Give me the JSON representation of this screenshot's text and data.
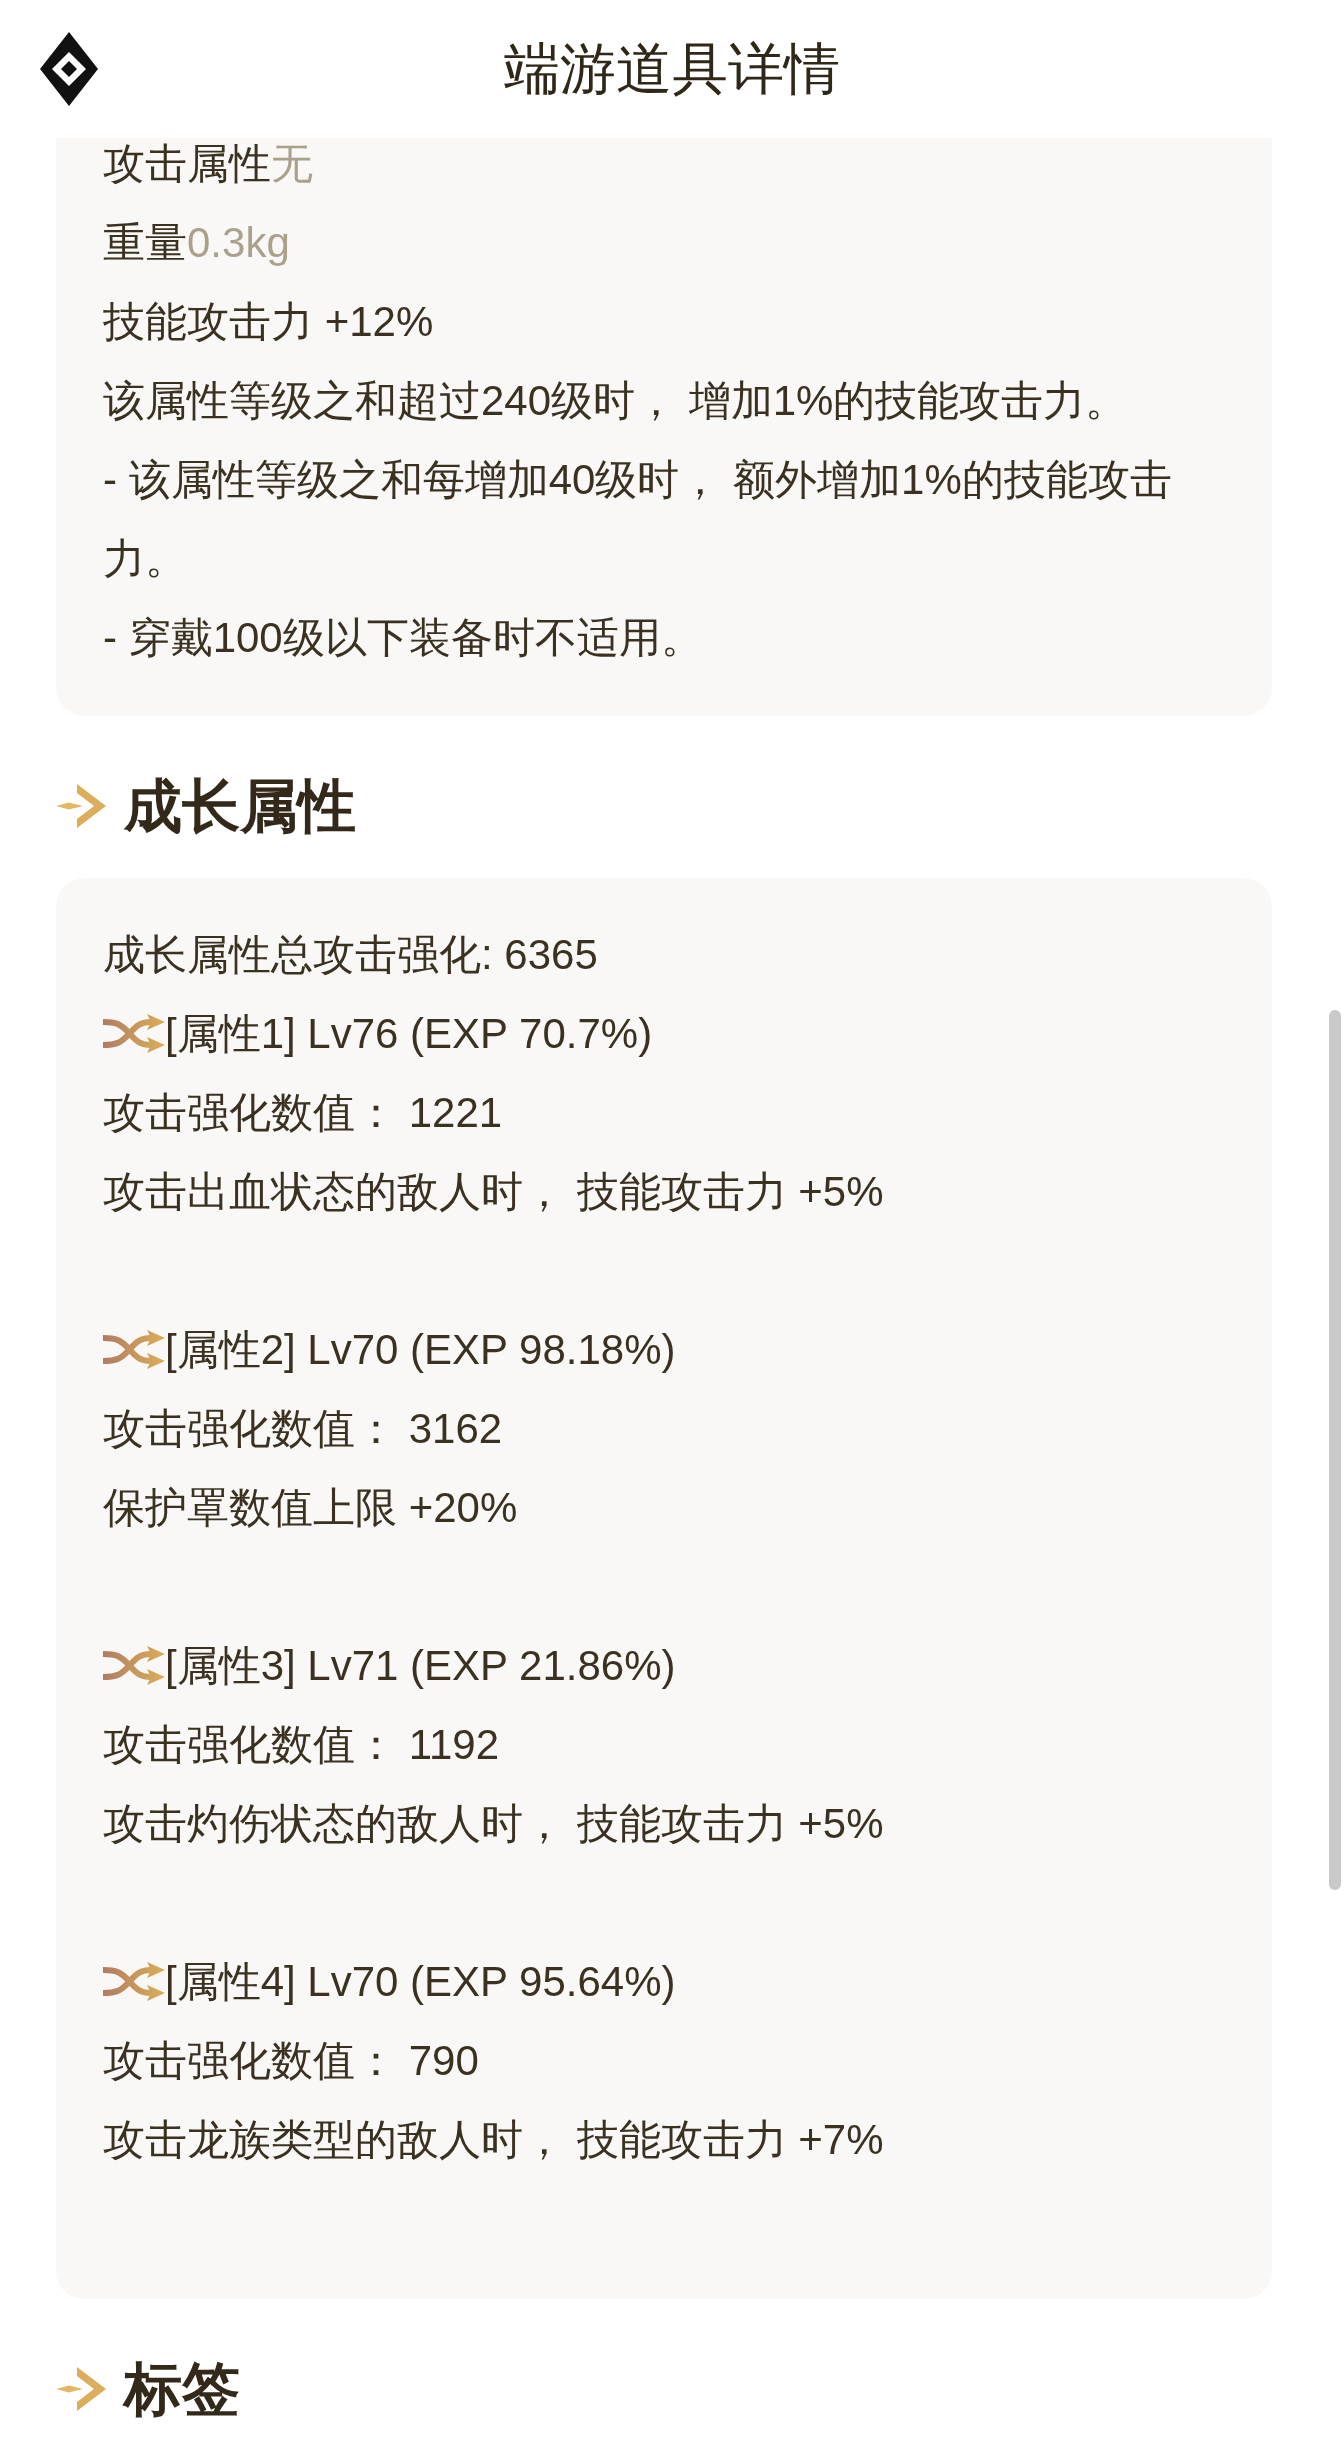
{
  "header": {
    "title": "端游道具详情"
  },
  "item_card": {
    "rows": [
      {
        "kind": "field",
        "label": "攻击属性",
        "value": "无"
      },
      {
        "kind": "field",
        "label": "重量",
        "value": "0.3kg"
      },
      {
        "kind": "text",
        "text": "技能攻击力 +12%"
      },
      {
        "kind": "text",
        "text": "该属性等级之和超过240级时， 增加1%的技能攻击力。"
      },
      {
        "kind": "text",
        "text": "- 该属性等级之和每增加40级时， 额外增加1%的技能攻击力。"
      },
      {
        "kind": "text",
        "text": "- 穿戴100级以下装备时不适用。"
      }
    ]
  },
  "growth_section": {
    "title": "成长属性",
    "total": "成长属性总攻击强化: 6365",
    "attributes": [
      {
        "name": "[属性1] Lv76 (EXP 70.7%)",
        "value": "攻击强化数值： 1221",
        "effect": "攻击出血状态的敌人时， 技能攻击力 +5%"
      },
      {
        "name": "[属性2] Lv70 (EXP 98.18%)",
        "value": "攻击强化数值： 3162",
        "effect": "保护罩数值上限 +20%"
      },
      {
        "name": "[属性3] Lv71 (EXP 21.86%)",
        "value": "攻击强化数值： 1192",
        "effect": "攻击灼伤状态的敌人时， 技能攻击力 +5%"
      },
      {
        "name": "[属性4] Lv70 (EXP 95.64%)",
        "value": "攻击强化数值： 790",
        "effect": "攻击龙族类型的敌人时， 技能攻击力 +7%"
      }
    ]
  },
  "tags_section": {
    "title": "标签"
  }
}
